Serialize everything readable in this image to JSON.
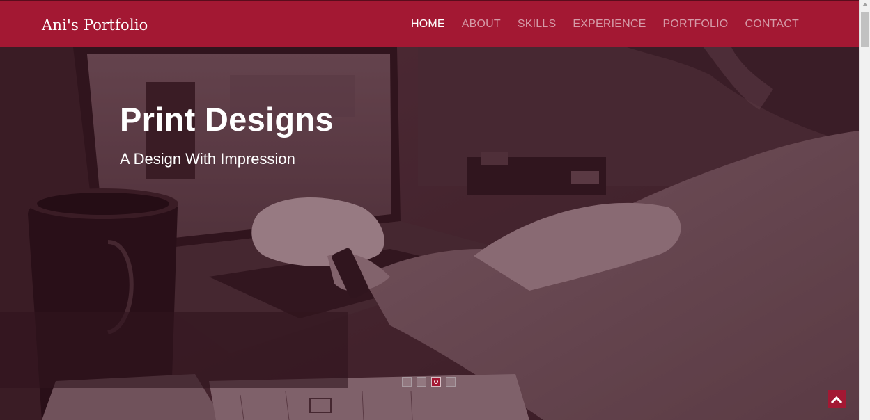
{
  "header": {
    "brand": "Ani's Portfolio",
    "nav": [
      {
        "label": "HOME",
        "active": true
      },
      {
        "label": "ABOUT",
        "active": false
      },
      {
        "label": "SKILLS",
        "active": false
      },
      {
        "label": "EXPERIENCE",
        "active": false
      },
      {
        "label": "PORTFOLIO",
        "active": false
      },
      {
        "label": "CONTACT",
        "active": false
      }
    ]
  },
  "hero": {
    "title": "Print Designs",
    "subtitle": "A Design With Impression",
    "background_image": "person-typing-on-laptop-with-coffee-mug",
    "slides": {
      "count": 4,
      "active_index": 2
    }
  },
  "controls": {
    "back_to_top_icon": "chevron-up-icon"
  },
  "colors": {
    "brand": "#a31833",
    "nav_inactive": "#d59aa7",
    "nav_active": "#ffffff",
    "overlay": "#3c1220"
  }
}
